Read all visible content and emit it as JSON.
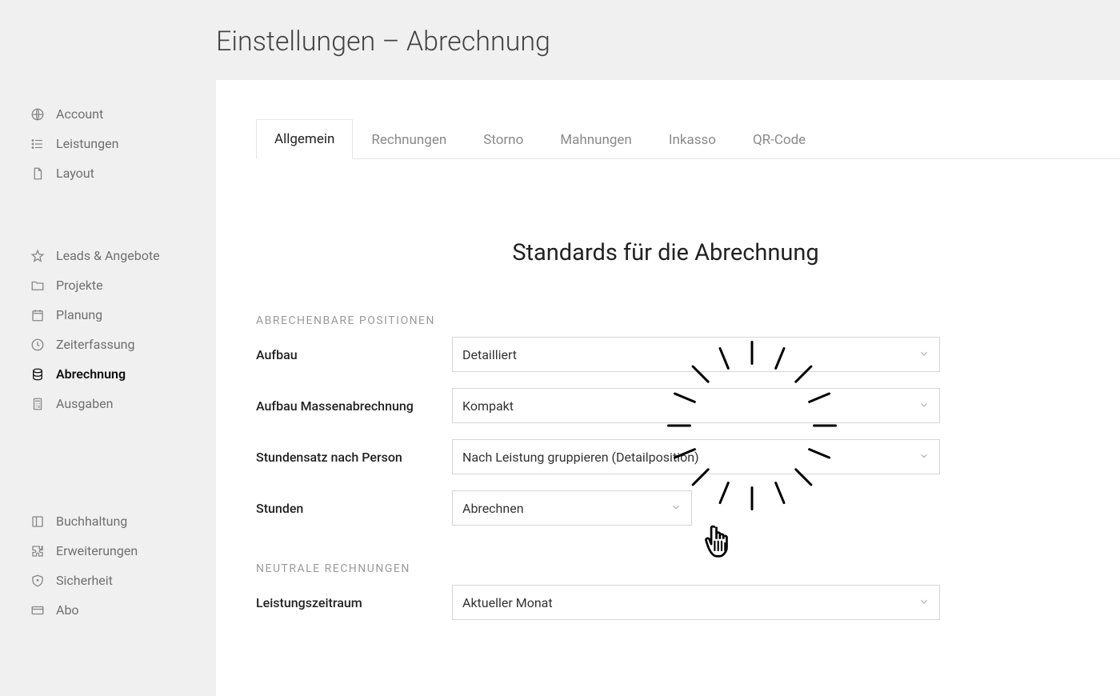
{
  "page_title": "Einstellungen – Abrechnung",
  "sidebar": {
    "items": [
      {
        "label": "Account",
        "icon": "globe-icon"
      },
      {
        "label": "Leistungen",
        "icon": "list-icon"
      },
      {
        "label": "Layout",
        "icon": "file-icon"
      }
    ],
    "items2": [
      {
        "label": "Leads & Angebote",
        "icon": "star-icon"
      },
      {
        "label": "Projekte",
        "icon": "folder-icon"
      },
      {
        "label": "Planung",
        "icon": "calendar-icon"
      },
      {
        "label": "Zeiterfassung",
        "icon": "clock-icon"
      },
      {
        "label": "Abrechnung",
        "icon": "database-icon",
        "active": true
      },
      {
        "label": "Ausgaben",
        "icon": "calculator-icon"
      }
    ],
    "items3": [
      {
        "label": "Buchhaltung",
        "icon": "ledger-icon"
      },
      {
        "label": "Erweiterungen",
        "icon": "puzzle-icon"
      },
      {
        "label": "Sicherheit",
        "icon": "shield-icon"
      },
      {
        "label": "Abo",
        "icon": "card-icon"
      }
    ]
  },
  "tabs": [
    {
      "label": "Allgemein",
      "active": true
    },
    {
      "label": "Rechnungen"
    },
    {
      "label": "Storno"
    },
    {
      "label": "Mahnungen"
    },
    {
      "label": "Inkasso"
    },
    {
      "label": "QR-Code"
    }
  ],
  "section_title": "Standards für die Abrechnung",
  "group1_header": "ABRECHENBARE POSITIONEN",
  "rows": {
    "aufbau_label": "Aufbau",
    "aufbau_value": "Detailliert",
    "massen_label": "Aufbau Massenabrechnung",
    "massen_value": "Kompakt",
    "stundenperson_label": "Stundensatz nach Person",
    "stundenperson_value": "Nach Leistung gruppieren (Detailposition)",
    "stunden_label": "Stunden",
    "stunden_value": "Abrechnen"
  },
  "group2_header": "NEUTRALE RECHNUNGEN",
  "rows2": {
    "zeitraum_label": "Leistungszeitraum",
    "zeitraum_value": "Aktueller Monat"
  }
}
